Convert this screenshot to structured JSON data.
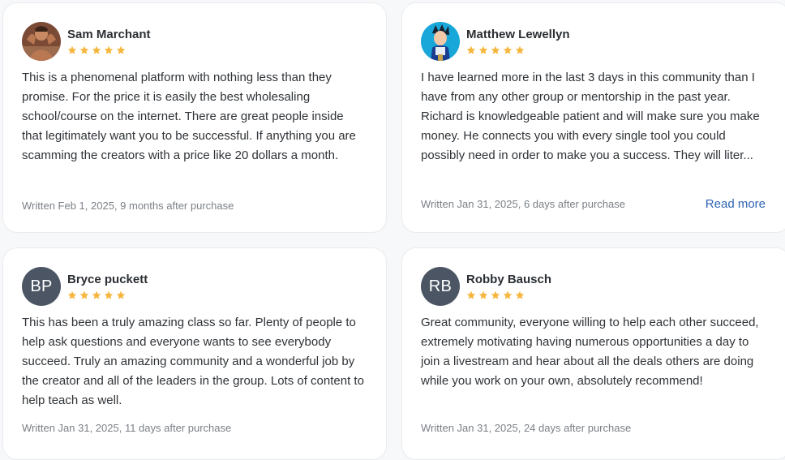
{
  "colors": {
    "star": "#f6b63d",
    "avatar_bg": "#4b5563",
    "link": "#2f64b3",
    "meta_text": "#7b8087"
  },
  "icons": {
    "rating": "star-icon"
  },
  "reviews": [
    {
      "name": "Sam Marchant",
      "avatar": "photo",
      "rating": 5,
      "text": "This is a phenomenal platform with nothing less than they promise. For the price it is easily the best wholesaling school/course on the internet. There are great people inside that legitimately want you to be successful. If anything you are scamming the creators with a price like 20 dollars a month.",
      "meta": "Written Feb 1, 2025, 9 months after purchase"
    },
    {
      "name": "Matthew Lewellyn",
      "avatar": "photo",
      "rating": 5,
      "text": "I have learned more in the last 3 days in this community than I have from any other group or mentorship in the past year. Richard is knowledgeable patient and will make sure you make money. He connects you with every single tool you could possibly need in order to make you a success. They will liter...",
      "meta": "Written Jan 31, 2025, 6 days after purchase",
      "read_more": "Read more"
    },
    {
      "name": "Bryce puckett",
      "avatar_initials": "BP",
      "rating": 5,
      "text": "This has been a truly amazing class so far. Plenty of people to help ask questions and everyone wants to see everybody succeed. Truly an amazing community and a wonderful job by the creator and all of the leaders in the group. Lots of content to help teach as well.",
      "meta": "Written Jan 31, 2025, 11 days after purchase"
    },
    {
      "name": "Robby Bausch",
      "avatar_initials": "RB",
      "rating": 5,
      "text": "Great community, everyone willing to help each other succeed, extremely motivating having numerous opportunities a day to join a livestream and hear about all the deals others are doing while you work on your own, absolutely recommend!",
      "meta": "Written Jan 31, 2025, 24 days after purchase"
    }
  ]
}
